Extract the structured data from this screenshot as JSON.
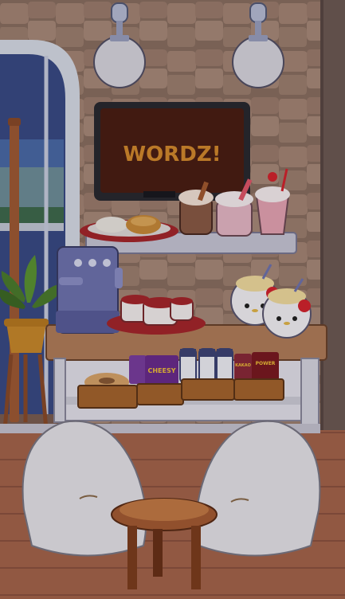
{
  "tv": {
    "screen_text": "WORDZ!"
  },
  "snacks": {
    "chips_label": "CHEESY",
    "candy_label_a": "KAKAO",
    "candy_label_b": "POWER"
  },
  "colors": {
    "wall": "#8e7364",
    "stone": "#a9897a",
    "floor": "#a5654c",
    "table_top": "#b27e5b",
    "accent_red": "#a6262c",
    "tv_glow": "#d48a2e"
  },
  "icons": [
    "wall-lamp-icon",
    "tv-icon",
    "coffee-machine-icon",
    "plant-icon",
    "beanbag-icon",
    "stool-icon"
  ]
}
